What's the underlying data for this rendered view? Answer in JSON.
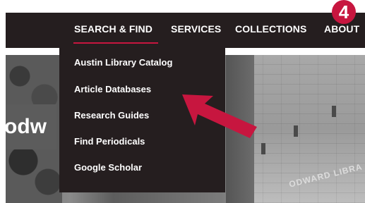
{
  "nav": {
    "items": [
      {
        "label": "SEARCH & FIND"
      },
      {
        "label": "SERVICES"
      },
      {
        "label": "COLLECTIONS"
      },
      {
        "label": "ABOUT"
      }
    ]
  },
  "dropdown": {
    "items": [
      {
        "label": "Austin Library Catalog"
      },
      {
        "label": "Article Databases"
      },
      {
        "label": "Research Guides"
      },
      {
        "label": "Find Periodicals"
      },
      {
        "label": "Google Scholar"
      }
    ]
  },
  "banner": {
    "text": "odw"
  },
  "step": {
    "number": "4"
  },
  "building": {
    "sign": "ODWARD LIBRA"
  },
  "colors": {
    "accent": "#c7163f",
    "nav_bg": "#251e1f"
  }
}
